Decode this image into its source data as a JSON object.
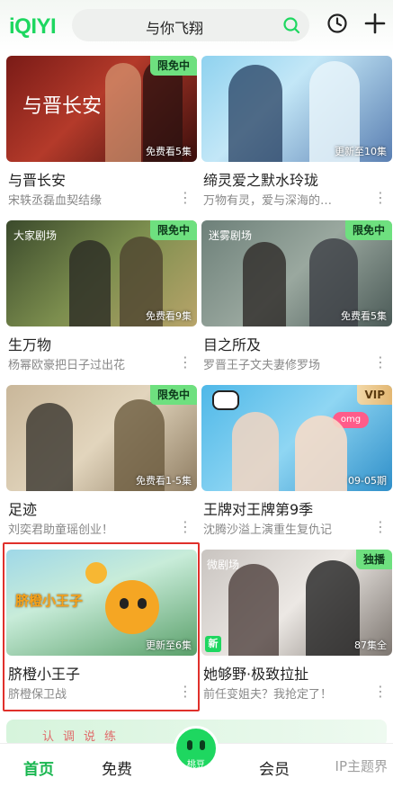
{
  "header": {
    "logo": "iQIYI",
    "search_text": "与你飞翔"
  },
  "cards": [
    {
      "title": "与晋长安",
      "subtitle": "宋轶丞磊血契结缘",
      "badge": "限免中",
      "corner": "免费看5集",
      "badge_type": "free"
    },
    {
      "title": "缔灵爱之默水玲珑",
      "subtitle": "万物有灵，爱与深海的…",
      "badge": "",
      "corner": "更新至10集",
      "badge_type": ""
    },
    {
      "title": "生万物",
      "subtitle": "杨幂欧豪把日子过出花",
      "badge": "限免中",
      "corner": "免费看9集",
      "badge_type": "free"
    },
    {
      "title": "目之所及",
      "subtitle": "罗晋王子文夫妻修罗场",
      "badge": "限免中",
      "corner": "免费看5集",
      "badge_type": "free"
    },
    {
      "title": "足迹",
      "subtitle": "刘奕君助童瑶创业！",
      "badge": "限免中",
      "corner": "免费看1-5集",
      "badge_type": "free"
    },
    {
      "title": "王牌对王牌第9季",
      "subtitle": "沈腾沙溢上演重生复仇记",
      "badge": "VIP",
      "corner": "09-05期",
      "badge_type": "vip"
    },
    {
      "title": "脐橙小王子",
      "subtitle": "脐橙保卫战",
      "badge": "",
      "corner": "更新至6集",
      "badge_type": ""
    },
    {
      "title": "她够野·极致拉扯",
      "subtitle": "前任变姐夫？我抢定了！",
      "badge": "独播",
      "corner": "87集全",
      "badge_type": "free",
      "new_tag": "新"
    }
  ],
  "banner": {
    "text": "认调说练"
  },
  "tabbar": {
    "home": "首页",
    "free": "免费",
    "center": "桃豆",
    "vip": "会员",
    "watermark": "IP主题界"
  },
  "colors": {
    "accent": "#1ed760",
    "badge_green": "#6ee07f",
    "highlight": "#e0302b"
  }
}
